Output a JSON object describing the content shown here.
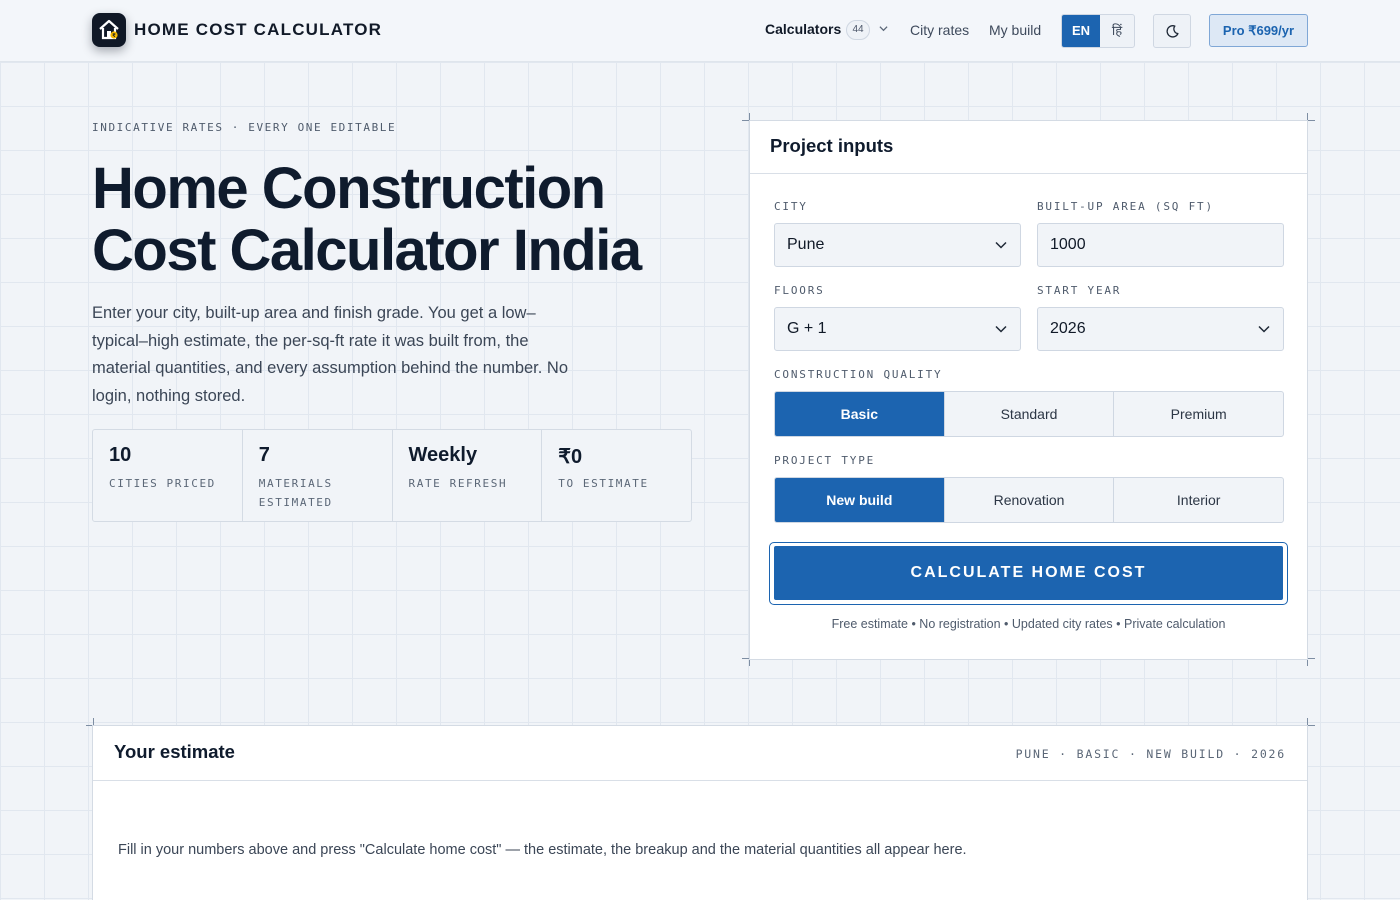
{
  "header": {
    "brand": "HOME COST CALCULATOR",
    "nav": {
      "calculators_label": "Calculators",
      "calculators_count": "44",
      "city_rates": "City rates",
      "my_build": "My build"
    },
    "lang": {
      "en": "EN",
      "hi": "हिं",
      "active": "EN"
    },
    "pro_label": "Pro ₹699/yr"
  },
  "hero": {
    "eyebrow": "INDICATIVE RATES · EVERY ONE EDITABLE",
    "title_line1": "Home Construction",
    "title_line2": "Cost Calculator India",
    "description": "Enter your city, built-up area and finish grade. You get a low–typical–high estimate, the per-sq-ft rate it was built from, the material quantities, and every assumption behind the number. No login, nothing stored.",
    "stats": [
      {
        "value": "10",
        "label": "CITIES PRICED"
      },
      {
        "value": "7",
        "label": "MATERIALS ESTIMATED"
      },
      {
        "value": "Weekly",
        "label": "RATE REFRESH"
      },
      {
        "value": "₹0",
        "label": "TO ESTIMATE"
      }
    ]
  },
  "inputs": {
    "title": "Project inputs",
    "city": {
      "label": "CITY",
      "value": "Pune"
    },
    "area": {
      "label": "BUILT-UP AREA (SQ FT)",
      "value": "1000"
    },
    "floors": {
      "label": "FLOORS",
      "value": "G + 1"
    },
    "start_year": {
      "label": "START YEAR",
      "value": "2026"
    },
    "quality": {
      "label": "CONSTRUCTION QUALITY",
      "options": [
        "Basic",
        "Standard",
        "Premium"
      ],
      "selected": "Basic"
    },
    "project_type": {
      "label": "PROJECT TYPE",
      "options": [
        "New build",
        "Renovation",
        "Interior"
      ],
      "selected": "New build"
    },
    "calculate_label": "CALCULATE HOME COST",
    "footnote": "Free estimate • No registration • Updated city rates • Private calculation"
  },
  "estimate": {
    "title": "Your estimate",
    "meta": "PUNE · BASIC · NEW BUILD · 2026",
    "message": "Fill in your numbers above and press \"Calculate home cost\" — the estimate, the breakup and the material quantities all appear here."
  },
  "colors": {
    "accent": "#1c64b0",
    "ink": "#0f1b2d",
    "background": "#f1f4f8"
  },
  "icons": [
    "house-logo-icon",
    "chevron-down-icon",
    "moon-icon"
  ]
}
